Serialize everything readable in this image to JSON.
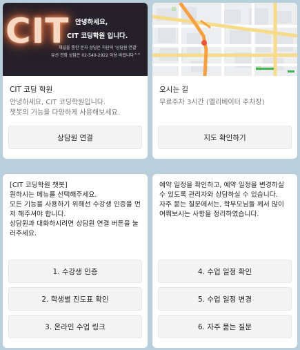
{
  "cards": [
    {
      "title": "CIT 코딩 학원",
      "description": "안녕하세요, CIT 코딩학원입니다.\n챗봇의 기능을 다양하게 사용해보세요.",
      "thumbnail": {
        "logo_text": "CIT",
        "greeting_line1": "안녕하세요,",
        "greeting_line2": "CIT 코딩학원 입니다.",
        "small_line1": "채널을 통한 문자 상담은 하단의 '상담원 연결'",
        "small_line2": "유선 전화 상담은 02-540-2922 이용 바랍니다^^"
      },
      "button": "상담원 연결"
    },
    {
      "title": "오시는 길",
      "description": "무료주차 3시간 (엘리베이터 주차장)",
      "thumbnail": {
        "type": "map"
      },
      "button": "지도 확인하기"
    },
    {
      "text": "[CIT 코딩학원 챗봇]\n원하시는 메뉴를 선택해주세요.\n모든 기능을 사용하기 위해선 수강생 인증을 먼저 해주셔야 합니다.\n상담원과 대화하시려면 상담원 연결 버튼을 눌러주세요.",
      "buttons": [
        "1. 수강생 인증",
        "2. 학생별 진도표 확인",
        "3. 온라인 수업 링크"
      ]
    },
    {
      "text": "예약 일정을 확인하고, 예약 일정을 변경하실 수 있도록 관리자와 상담하실 수 있습니다.\n자주 묻는 질문에서는, 학부모님들 께서 많이 여쭤보시는 사항을 정리하였습니다.",
      "buttons": [
        "4. 수업 일정 확인",
        "5. 수업 일정 변경",
        "6. 자주 묻는 질문"
      ]
    }
  ],
  "colors": {
    "background": "#b9cfdb",
    "card": "#ffffff",
    "button": "#f4f4f4",
    "route": "#f5a142"
  }
}
